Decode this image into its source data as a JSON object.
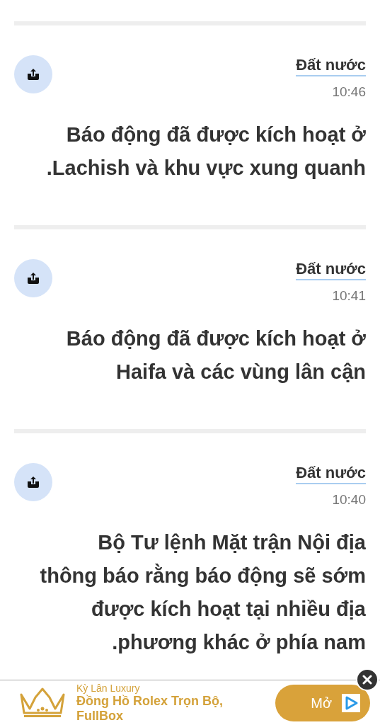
{
  "feed": [
    {
      "category": "Đất nước",
      "time": "10:46",
      "headline_lines": [
        "Báo động đã được kích hoạt ở",
        ".Lachish và khu vực xung quanh"
      ]
    },
    {
      "category": "Đất nước",
      "time": "10:41",
      "headline_lines": [
        "Báo động đã được kích hoạt ở",
        "Haifa và các vùng lân cận"
      ]
    },
    {
      "category": "Đất nước",
      "time": "10:40",
      "headline_lines": [
        "Bộ Tư lệnh Mặt trận Nội địa",
        "thông báo rằng báo động sẽ sớm",
        "được kích hoạt tại nhiều địa",
        ".phương khác ở phía nam"
      ]
    }
  ],
  "ad": {
    "advertiser": "Kỳ Lân Luxury",
    "headline": "Đồng Hồ Rolex Trọn Bộ, FullBox",
    "button": "Mở"
  }
}
